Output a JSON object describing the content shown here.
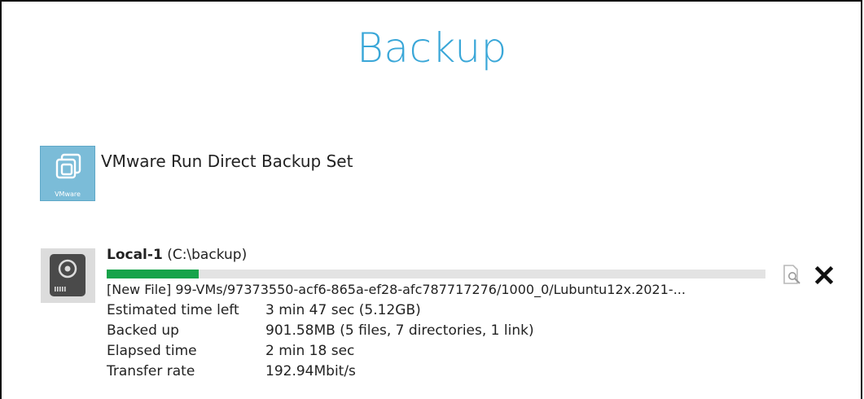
{
  "header": {
    "title": "Backup"
  },
  "backup_set": {
    "name": "VMware Run Direct Backup Set",
    "icon_label": "VMware",
    "icon": "vmware-icon"
  },
  "destination": {
    "name": "Local-1",
    "path": "(C:\\backup)",
    "icon": "hard-drive-icon",
    "progress_fraction": 0.14,
    "current_file": "[New File] 99-VMs/97373550-acf6-865a-ef28-afc787717276/1000_0/Lubuntu12x.2021-...",
    "stats": [
      {
        "label": "Estimated time left",
        "value": "3 min 47 sec (5.12GB)"
      },
      {
        "label": "Backed up",
        "value": "901.58MB (5 files, 7 directories, 1 link)"
      },
      {
        "label": "Elapsed time",
        "value": "2 min 18 sec"
      },
      {
        "label": "Transfer rate",
        "value": "192.94Mbit/s"
      }
    ]
  },
  "actions": {
    "view_icon": "view-log-icon",
    "close_icon": "close-icon"
  },
  "colors": {
    "title": "#3aa7d8",
    "progress_fill": "#17a34a",
    "progress_track": "#e3e3e3",
    "icon_bg": "#7bbcd8"
  }
}
